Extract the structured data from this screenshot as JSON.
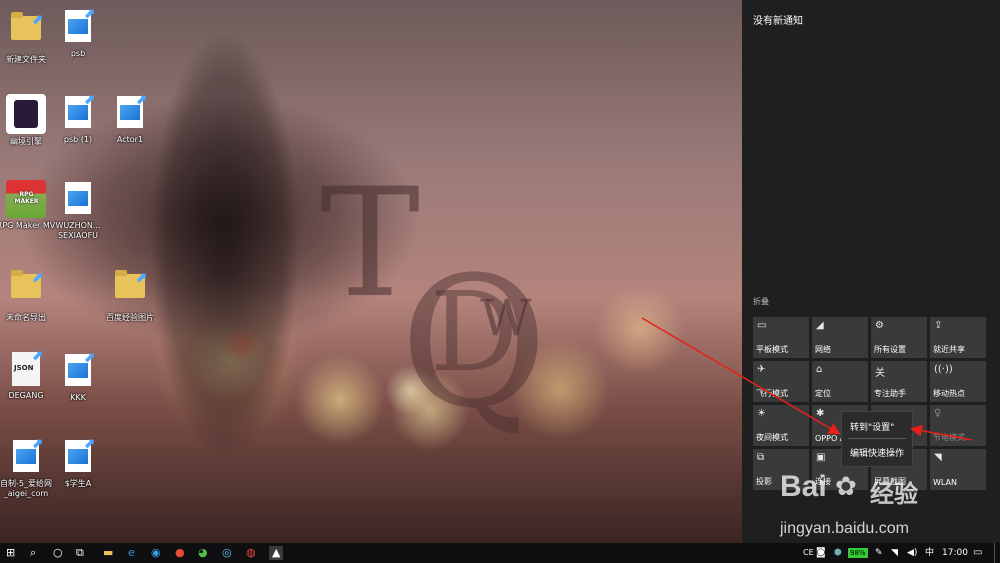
{
  "desktop": {
    "icons": [
      {
        "label": "新建文件夹",
        "kind": "folder"
      },
      {
        "label": "psb",
        "kind": "image"
      },
      {
        "label": "幽境引擎",
        "kind": "app"
      },
      {
        "label": "psb (1)",
        "kind": "image"
      },
      {
        "label": "Actor1",
        "kind": "image"
      },
      {
        "label": "RPG Maker MV",
        "kind": "app"
      },
      {
        "label": "WUZHON... SEXIAOFU",
        "kind": "image"
      },
      {
        "label": "未命名导出",
        "kind": "folder"
      },
      {
        "label": "百度经验图片",
        "kind": "folder"
      },
      {
        "label": "DEGANG",
        "kind": "json"
      },
      {
        "label": "KKK",
        "kind": "image"
      },
      {
        "label": "自制-5_爱给网_aigei_com",
        "kind": "image"
      },
      {
        "label": "$学生A",
        "kind": "image"
      }
    ],
    "app_badges": {
      "json": "JSON",
      "rpg": "RPG MAKER"
    },
    "watermark_letters": {
      "t": "T",
      "q": "Q",
      "d": "D",
      "w": "W"
    }
  },
  "action_center": {
    "title": "没有新通知",
    "collapse_label": "折叠",
    "tiles": [
      {
        "label": "平板模式",
        "icon": "tablet-icon",
        "glyph": "▭"
      },
      {
        "label": "网络",
        "icon": "network-icon",
        "glyph": "◢"
      },
      {
        "label": "所有设置",
        "icon": "gear-icon",
        "glyph": "⚙"
      },
      {
        "label": "就近共享",
        "icon": "share-icon",
        "glyph": "⇪"
      },
      {
        "label": "飞行模式",
        "icon": "airplane-icon",
        "glyph": "✈"
      },
      {
        "label": "定位",
        "icon": "location-icon",
        "glyph": "⌂"
      },
      {
        "label": "专注助手",
        "icon": "focus-icon",
        "glyph": "关"
      },
      {
        "label": "移动热点",
        "icon": "hotspot-icon",
        "glyph": "((·))"
      },
      {
        "label": "夜间模式",
        "icon": "night-light-icon",
        "glyph": "☀"
      },
      {
        "label": "OPPO A",
        "icon": "bluetooth-icon",
        "glyph": "✱"
      },
      {
        "label": "",
        "icon": "blank-icon",
        "glyph": ""
      },
      {
        "label": "节电模式",
        "icon": "battery-saver-icon",
        "glyph": "♀"
      },
      {
        "label": "投影",
        "icon": "project-icon",
        "glyph": "⧉"
      },
      {
        "label": "连接",
        "icon": "connect-icon",
        "glyph": "▣"
      },
      {
        "label": "屏幕截图",
        "icon": "screenshot-icon",
        "glyph": "✂"
      },
      {
        "label": "WLAN",
        "icon": "wlan-icon",
        "glyph": "◥"
      }
    ],
    "context_menu": {
      "item1": "转到\"设置\"",
      "item2": "编辑快速操作"
    }
  },
  "taskbar": {
    "ime": "CE",
    "battery": "98%",
    "time": "17:00",
    "lang": "中"
  },
  "watermark_baidu": {
    "brand": "Bai",
    "jingyan": "经验",
    "url": "jingyan.baidu.com"
  }
}
